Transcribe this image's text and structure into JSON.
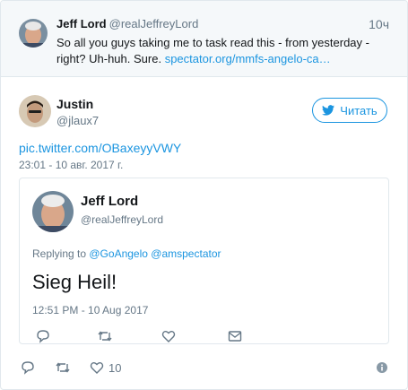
{
  "parent_tweet": {
    "name": "Jeff Lord",
    "handle": "@realJeffreyLord",
    "time": "10ч",
    "text": "So all you guys taking me to task read this - from yesterday - right? Uh-huh. Sure. ",
    "link": "spectator.org/mmfs-angelo-ca…"
  },
  "main_tweet": {
    "name": "Justin",
    "handle": "@jlaux7",
    "follow_label": "Читать",
    "link": "pic.twitter.com/OBaxeyyVWY",
    "date": "23:01 - 10 авг. 2017 г.",
    "like_count": "10"
  },
  "quoted_tweet": {
    "name": "Jeff Lord",
    "handle": "@realJeffreyLord",
    "replying_prefix": "Replying to ",
    "mention_1": "@GoAngelo",
    "mention_2": "@amspectator",
    "text": "Sieg Heil!",
    "date": "12:51 PM - 10 Aug 2017"
  },
  "colors": {
    "accent": "#1b95e0",
    "muted": "#657786",
    "border": "#e1e8ed",
    "parent_bg": "#f5f8fa"
  }
}
